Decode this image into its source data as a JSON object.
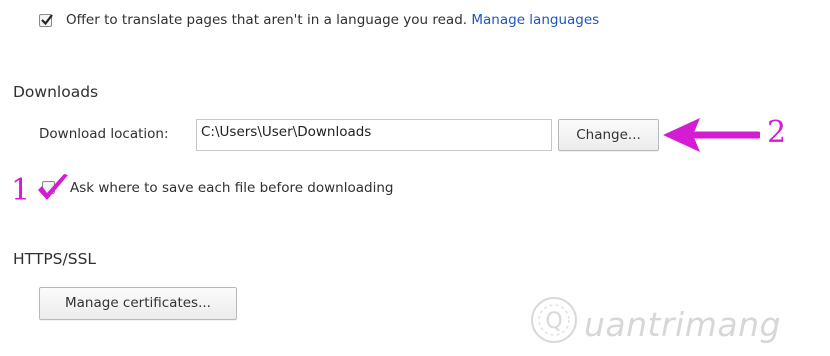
{
  "translate": {
    "checked": true,
    "label": "Offer to translate pages that aren't in a language you read.",
    "link": "Manage languages"
  },
  "downloads": {
    "title": "Downloads",
    "location_label": "Download location:",
    "location_value": "C:\\Users\\User\\Downloads",
    "change_button": "Change...",
    "ask_checked": true,
    "ask_label": "Ask where to save each file before downloading"
  },
  "https": {
    "title": "HTTPS/SSL",
    "manage_button": "Manage certificates..."
  },
  "annotations": {
    "marker_1": "1",
    "marker_2": "2",
    "color": "#d31cd3"
  },
  "watermark": {
    "text": "uantrimang",
    "logo_letter": "Q"
  }
}
